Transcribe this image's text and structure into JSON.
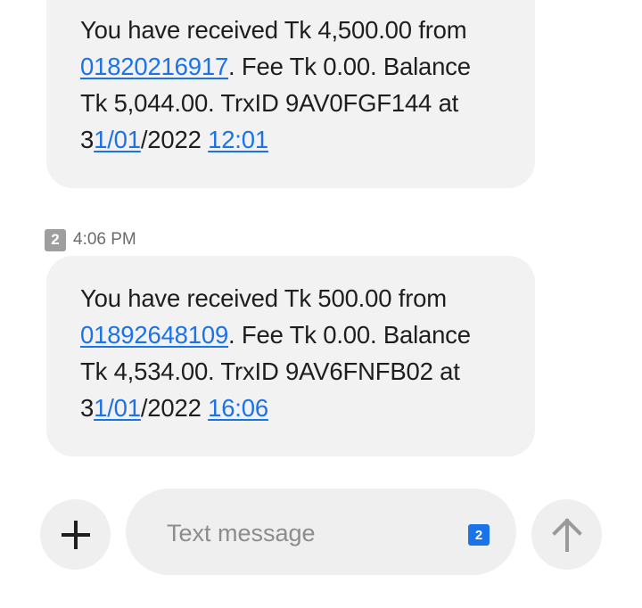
{
  "messages": [
    {
      "p1": "You have received Tk 4,500.00 from ",
      "phone": "01820216917",
      "p2": ". Fee Tk 0.00. Balance Tk 5,044.00. TrxID 9AV0FGF144 at 3",
      "date_link": "1/01",
      "p3": "/2022 ",
      "time_link": "12:01"
    },
    {
      "p1": "You have received Tk 500.00 from ",
      "phone": "01892648109",
      "p2": ". Fee Tk 0.00. Balance Tk 4,534.00. TrxID 9AV6FNFB02 at 3",
      "date_link": "1/01",
      "p3": "/2022 ",
      "time_link": "16:06"
    }
  ],
  "timestamp": {
    "sim": "2",
    "time": "4:06 PM"
  },
  "composer": {
    "placeholder": "Text message",
    "sim": "2"
  },
  "icons": {
    "add": "plus-icon",
    "send": "arrow-up-icon"
  },
  "colors": {
    "link": "#1a73e8",
    "bubble": "#f2f2f2",
    "sim_badge_active": "#1a73e8",
    "sim_badge_meta": "#9e9e9e"
  }
}
